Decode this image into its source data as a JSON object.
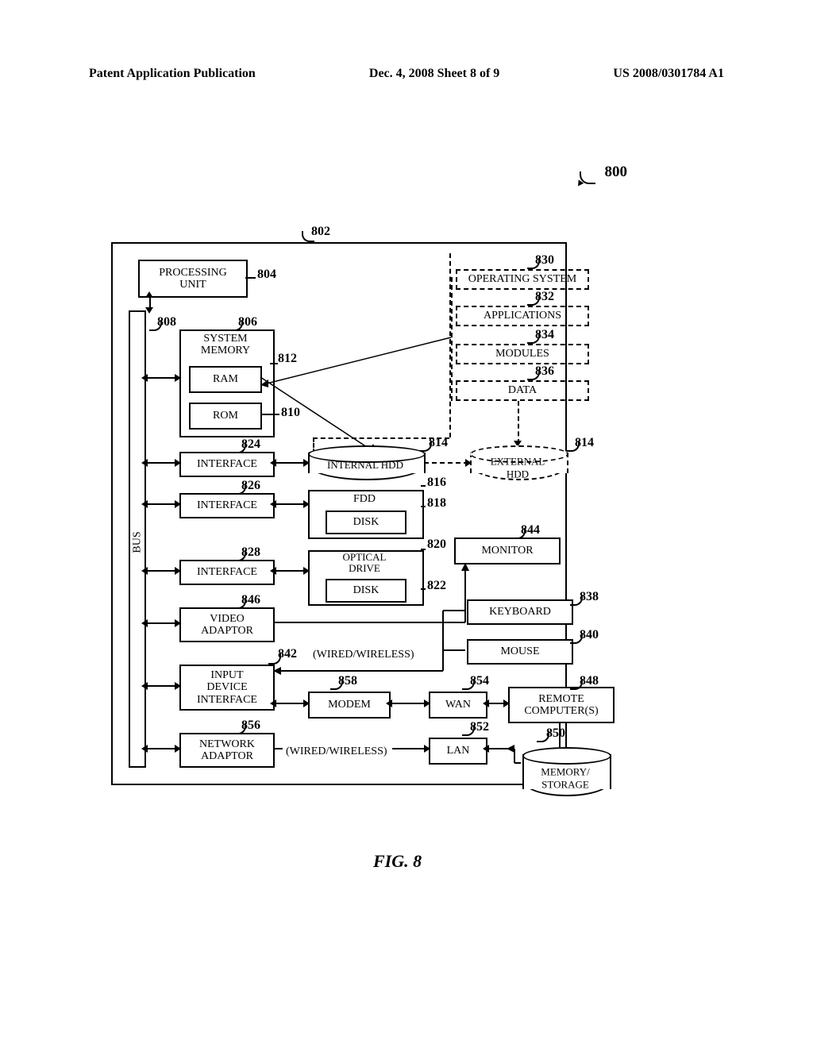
{
  "header": {
    "left": "Patent Application Publication",
    "center": "Dec. 4, 2008  Sheet 8 of 9",
    "right": "US 2008/0301784 A1"
  },
  "fig_ref": "800",
  "frame_ref": "802",
  "blocks": {
    "processing_unit": {
      "label": "PROCESSING\nUNIT",
      "ref": "804"
    },
    "system_memory": {
      "label": "SYSTEM\nMEMORY",
      "ref": "806"
    },
    "bus_ref": "808",
    "ram": {
      "label": "RAM",
      "ref": "812"
    },
    "rom": {
      "label": "ROM",
      "ref": "810"
    },
    "interface1": {
      "label": "INTERFACE",
      "ref": "824"
    },
    "interface2": {
      "label": "INTERFACE",
      "ref": "826"
    },
    "interface3": {
      "label": "INTERFACE",
      "ref": "828"
    },
    "video_adaptor": {
      "label": "VIDEO\nADAPTOR",
      "ref": "846"
    },
    "input_device_interface": {
      "label": "INPUT\nDEVICE\nINTERFACE",
      "ref": "842"
    },
    "network_adaptor": {
      "label": "NETWORK\nADAPTOR",
      "ref": "856"
    },
    "internal_hdd": {
      "label": "INTERNAL HDD",
      "ref_a": "814"
    },
    "external_hdd": {
      "label": "EXTERNAL\nHDD",
      "ref": "814"
    },
    "fdd": {
      "label": "FDD",
      "ref": "816"
    },
    "fdd_disk": {
      "label": "DISK",
      "ref": "818"
    },
    "optical_drive": {
      "label": "OPTICAL\nDRIVE",
      "ref": "820"
    },
    "optical_disk": {
      "label": "DISK",
      "ref": "822"
    },
    "modem": {
      "label": "MODEM",
      "ref": "858"
    },
    "wan": {
      "label": "WAN",
      "ref": "854"
    },
    "lan": {
      "label": "LAN",
      "ref": "852"
    },
    "monitor": {
      "label": "MONITOR",
      "ref": "844"
    },
    "keyboard": {
      "label": "KEYBOARD",
      "ref": "838"
    },
    "mouse": {
      "label": "MOUSE",
      "ref": "840"
    },
    "remote": {
      "label": "REMOTE\nCOMPUTER(S)",
      "ref": "848"
    },
    "memory_storage": {
      "label": "MEMORY/\nSTORAGE",
      "ref": "850"
    },
    "os": {
      "label": "OPERATING SYSTEM",
      "ref": "830"
    },
    "apps": {
      "label": "APPLICATIONS",
      "ref": "832"
    },
    "mods": {
      "label": "MODULES",
      "ref": "834"
    },
    "data": {
      "label": "DATA",
      "ref": "836"
    },
    "bus": {
      "label": "BUS"
    }
  },
  "annotations": {
    "wired_wireless": "(WIRED/WIRELESS)",
    "wired_wireless2": "(WIRED/WIRELESS)"
  },
  "caption": "FIG. 8"
}
